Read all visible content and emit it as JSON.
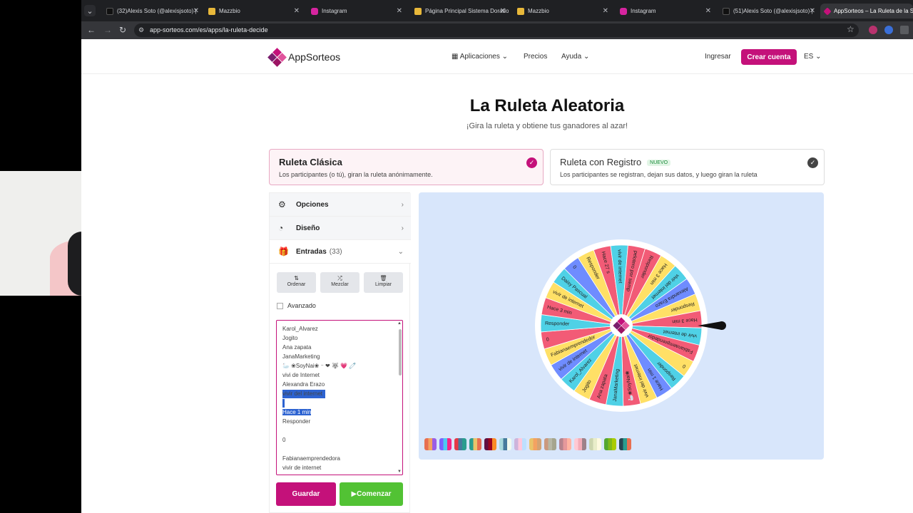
{
  "browser": {
    "tabs": [
      {
        "title": "(32)Alexis Soto (@alexisjsoto) |",
        "icon": "tiktok-icon",
        "color": "#111111"
      },
      {
        "title": "Mazzbio",
        "icon": "mazzbio-icon",
        "color": "#e8b83a"
      },
      {
        "title": "Instagram",
        "icon": "instagram-icon",
        "color": "#d6249f"
      },
      {
        "title": "Página Principal Sistema Dorado",
        "icon": "sistema-icon",
        "color": "#e8b83a"
      },
      {
        "title": "Mazzbio",
        "icon": "mazzbio-icon",
        "color": "#e8b83a"
      },
      {
        "title": "Instagram",
        "icon": "instagram-icon",
        "color": "#d6249f"
      },
      {
        "title": "(51)Alexis Soto (@alexisjsoto) |",
        "icon": "tiktok-icon",
        "color": "#111111"
      },
      {
        "title": "AppSorteos – La Ruleta de la S",
        "icon": "appsorteos-icon",
        "color": "#c4117a"
      }
    ],
    "url": "app-sorteos.com/es/apps/la-ruleta-decide"
  },
  "header": {
    "logo_brand": "AppSorteos",
    "nav": {
      "apps": "Aplicaciones",
      "prices": "Precios",
      "help": "Ayuda"
    },
    "login": "Ingresar",
    "create_account": "Crear cuenta",
    "language": "ES"
  },
  "main": {
    "title": "La Ruleta Aleatoria",
    "subtitle": "¡Gira la ruleta y obtiene tus ganadores al azar!",
    "modes": [
      {
        "title": "Ruleta Clásica",
        "desc": "Los participantes (o tú), giran la ruleta anónimamente.",
        "badge": ""
      },
      {
        "title": "Ruleta con Registro",
        "desc": "Los participantes se registran, dejan sus datos, y luego giran la ruleta",
        "badge": "NUEVO"
      }
    ]
  },
  "panel": {
    "options": "Opciones",
    "design": "Diseño",
    "entries": "Entradas",
    "entries_count": "(33)",
    "tools": {
      "sort": "Ordenar",
      "shuffle": "Mezclar",
      "clear": "Limpiar"
    },
    "advanced": "Avanzado",
    "entries_list": [
      "Karol_Alvarez",
      "Jogito",
      "Ana zapata",
      "JanaMarketing",
      "🦢 ❀SoyNai❀ ⁻ ❤ 🐺 💗 🧷",
      "vivi de Internet",
      "Alexandra Erazo",
      "vivir del internet",
      "",
      "Hace 1 min",
      "Responder",
      "",
      "0",
      "",
      "Fabianaemprendedora",
      "vivir de internet"
    ],
    "save": "Guardar",
    "start": "Comenzar"
  },
  "wheel": {
    "labels": [
      "Responder",
      "Hace 3 min",
      "vivir del internet",
      "Alexandra Erazo",
      "Responder",
      "Hace 3 min",
      "vivir de internet",
      "Fabianaemprendedora",
      "0",
      "Responder",
      "Hace 1 min",
      "vivir del internet",
      "🦢❀SoyNai❀",
      "JanaMarketing",
      "Ana zapata",
      "Jogito",
      "Karol_Alvarez",
      "vivir de internet",
      "Fabianaemprendedora",
      "0",
      "Responder",
      "Hace 3 min",
      "vivir de internet",
      "Daisy Pascual",
      "0",
      "Responder",
      "Hace 27 s",
      "vivir de internet",
      "pelotero por siemp"
    ],
    "colors": [
      "#f25b76",
      "#ffe066",
      "#4fd1e6",
      "#6f8cff",
      "#ffe066",
      "#f25b76",
      "#4fd1e6"
    ]
  },
  "palettes": [
    [
      "#e76f51",
      "#f4a261",
      "#9b5de5"
    ],
    [
      "#7b61ff",
      "#4cc9f0",
      "#f72585"
    ],
    [
      "#e63946",
      "#457b9d",
      "#2a9d8f"
    ],
    [
      "#2a9d8f",
      "#e9c46a",
      "#e76f51"
    ],
    [
      "#5f0f40",
      "#9a031e",
      "#fb8b24"
    ],
    [
      "#a8dadc",
      "#457b9d",
      "#f1faee"
    ],
    [
      "#cdb4db",
      "#ffc8dd",
      "#bde0fe"
    ],
    [
      "#e9c46a",
      "#f4a261",
      "#d4a373"
    ],
    [
      "#cb997e",
      "#b7b7a4",
      "#a5a58d"
    ],
    [
      "#b5838d",
      "#e5989b",
      "#ffb4a2"
    ],
    [
      "#ffcad4",
      "#f4acb7",
      "#9d8189"
    ],
    [
      "#ccd5ae",
      "#e9edc9",
      "#fefae0"
    ],
    [
      "#55a630",
      "#80b918",
      "#aacc00"
    ],
    [
      "#264653",
      "#2a9d8f",
      "#e76f51"
    ]
  ]
}
